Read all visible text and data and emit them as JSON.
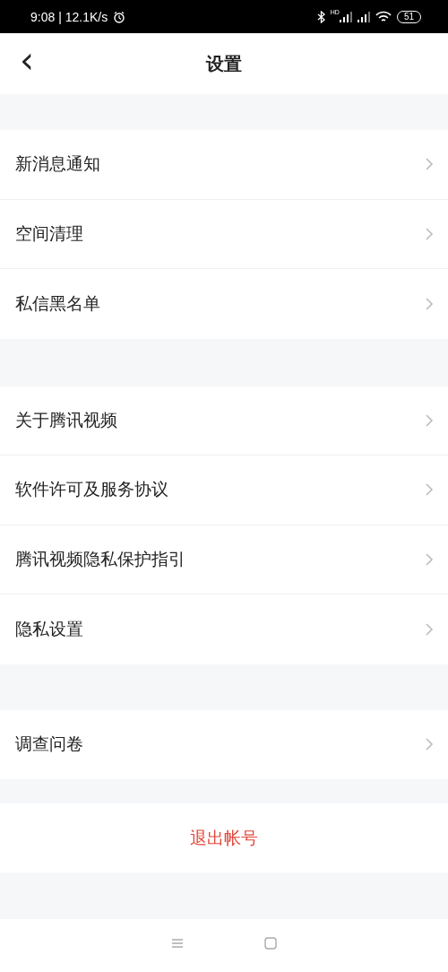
{
  "status_bar": {
    "time": "9:08 | 12.1K/s",
    "hd": "HD",
    "battery": "51"
  },
  "header": {
    "back": "‹",
    "title": "设置"
  },
  "groups": [
    {
      "items": [
        {
          "label": "新消息通知"
        },
        {
          "label": "空间清理"
        },
        {
          "label": "私信黑名单"
        }
      ]
    },
    {
      "items": [
        {
          "label": "关于腾讯视频"
        },
        {
          "label": "软件许可及服务协议"
        },
        {
          "label": "腾讯视频隐私保护指引"
        },
        {
          "label": "隐私设置"
        }
      ]
    },
    {
      "items": [
        {
          "label": "调查问卷"
        }
      ]
    }
  ],
  "logout": "退出帐号"
}
